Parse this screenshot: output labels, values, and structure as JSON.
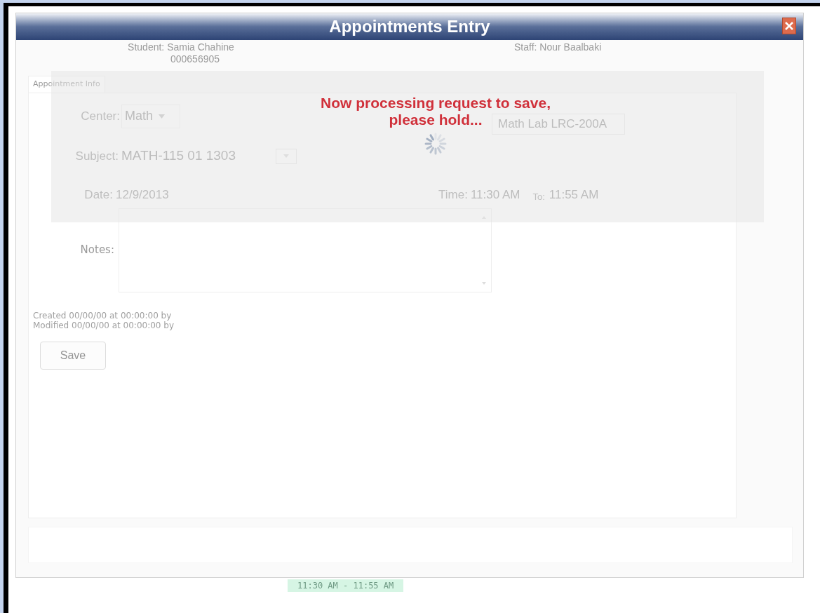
{
  "window": {
    "title": "Appointments Entry"
  },
  "header": {
    "student": "Student: Samia Chahine",
    "student_id": "000656905",
    "staff": "Staff: Nour Baalbaki"
  },
  "tab": {
    "label": "Appointment Info"
  },
  "form": {
    "center_label": "Center:",
    "center_value": "Math",
    "location_value": "Math Lab  LRC-200A",
    "subject_label": "Subject:",
    "subject_value": "MATH-115 01 1303",
    "date_label": "Date:",
    "date_value": "12/9/2013",
    "time_label": "Time:",
    "time_value": "11:30 AM",
    "to_label": "To:",
    "to_value": "11:55 AM",
    "notes_label": "Notes:"
  },
  "created": "Created 00/00/00 at 00:00:00 by",
  "modified": "Modified 00/00/00 at 00:00:00 by",
  "save_button": "Save",
  "overlay": {
    "message_line1": "Now processing request to save,",
    "message_line2": "please hold..."
  },
  "background_event": "11:30 AM - 11:55 AM"
}
